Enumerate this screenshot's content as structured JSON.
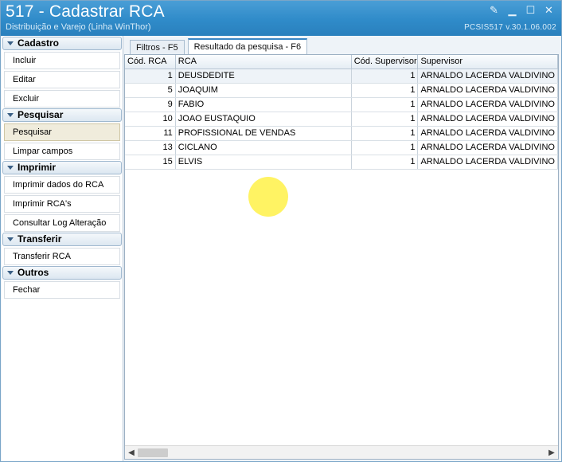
{
  "window": {
    "title": "517 - Cadastrar RCA",
    "subtitle": "Distribuição e Varejo (Linha WinThor)",
    "version": "PCSIS517  v.30.1.06.002"
  },
  "sidebar": {
    "groups": [
      {
        "label": "Cadastro",
        "items": [
          "Incluir",
          "Editar",
          "Excluir"
        ]
      },
      {
        "label": "Pesquisar",
        "items": [
          "Pesquisar",
          "Limpar campos"
        ]
      },
      {
        "label": "Imprimir",
        "items": [
          "Imprimir dados do RCA",
          "Imprimir RCA's",
          "Consultar Log Alteração"
        ]
      },
      {
        "label": "Transferir",
        "items": [
          "Transferir RCA"
        ]
      },
      {
        "label": "Outros",
        "items": [
          "Fechar"
        ]
      }
    ]
  },
  "tabs": [
    {
      "label": "Filtros - F5"
    },
    {
      "label": "Resultado da pesquisa - F6"
    }
  ],
  "grid": {
    "columns": [
      "Cód. RCA",
      "RCA",
      "Cód. Supervisor",
      "Supervisor"
    ],
    "rows": [
      [
        "1",
        "DEUSDEDITE",
        "1",
        "ARNALDO LACERDA VALDIVINO"
      ],
      [
        "5",
        "JOAQUIM",
        "1",
        "ARNALDO LACERDA VALDIVINO"
      ],
      [
        "9",
        "FABIO",
        "1",
        "ARNALDO LACERDA VALDIVINO"
      ],
      [
        "10",
        "JOAO EUSTAQUIO",
        "1",
        "ARNALDO LACERDA VALDIVINO"
      ],
      [
        "11",
        "PROFISSIONAL DE VENDAS",
        "1",
        "ARNALDO LACERDA VALDIVINO"
      ],
      [
        "13",
        "CICLANO",
        "1",
        "ARNALDO LACERDA VALDIVINO"
      ],
      [
        "15",
        "ELVIS",
        "1",
        "ARNALDO LACERDA VALDIVINO"
      ]
    ]
  }
}
